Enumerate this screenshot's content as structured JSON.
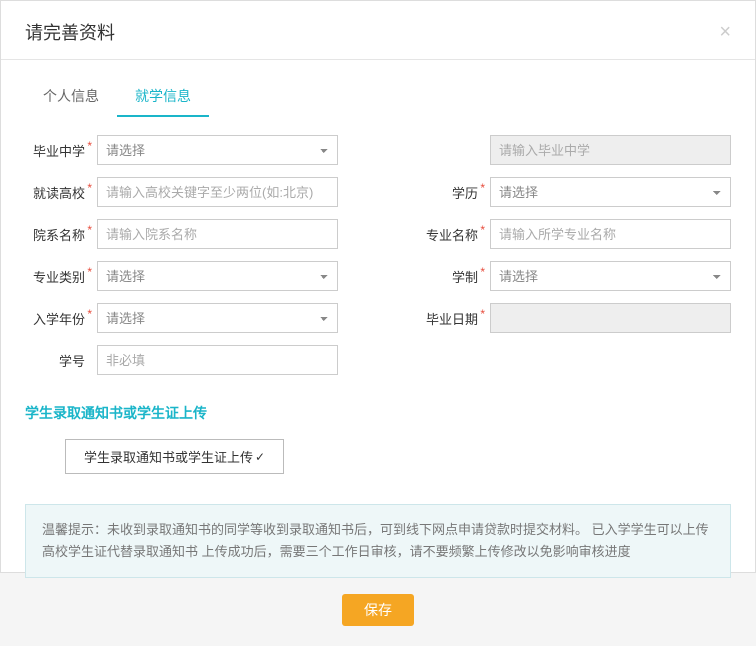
{
  "header": {
    "title": "请完善资料"
  },
  "tabs": {
    "personal": "个人信息",
    "education": "就学信息"
  },
  "fields": {
    "graduateSchool": {
      "label": "毕业中学",
      "placeholder": "请选择",
      "textPlaceholder": "请输入毕业中学"
    },
    "college": {
      "label": "就读高校",
      "placeholder": "请输入高校关键字至少两位(如:北京)"
    },
    "education": {
      "label": "学历",
      "placeholder": "请选择"
    },
    "department": {
      "label": "院系名称",
      "placeholder": "请输入院系名称"
    },
    "major": {
      "label": "专业名称",
      "placeholder": "请输入所学专业名称"
    },
    "majorType": {
      "label": "专业类别",
      "placeholder": "请选择"
    },
    "schoolSystem": {
      "label": "学制",
      "placeholder": "请选择"
    },
    "enrollYear": {
      "label": "入学年份",
      "placeholder": "请选择"
    },
    "gradDate": {
      "label": "毕业日期",
      "placeholder": ""
    },
    "studentId": {
      "label": "学号",
      "placeholder": "非必填"
    }
  },
  "upload": {
    "title": "学生录取通知书或学生证上传",
    "button": "学生录取通知书或学生证上传",
    "check": "✓"
  },
  "hint": "温馨提示：未收到录取通知书的同学等收到录取通知书后，可到线下网点申请贷款时提交材料。 已入学学生可以上传高校学生证代替录取通知书  上传成功后，需要三个工作日审核，请不要频繁上传修改以免影响审核进度",
  "save": "保存"
}
